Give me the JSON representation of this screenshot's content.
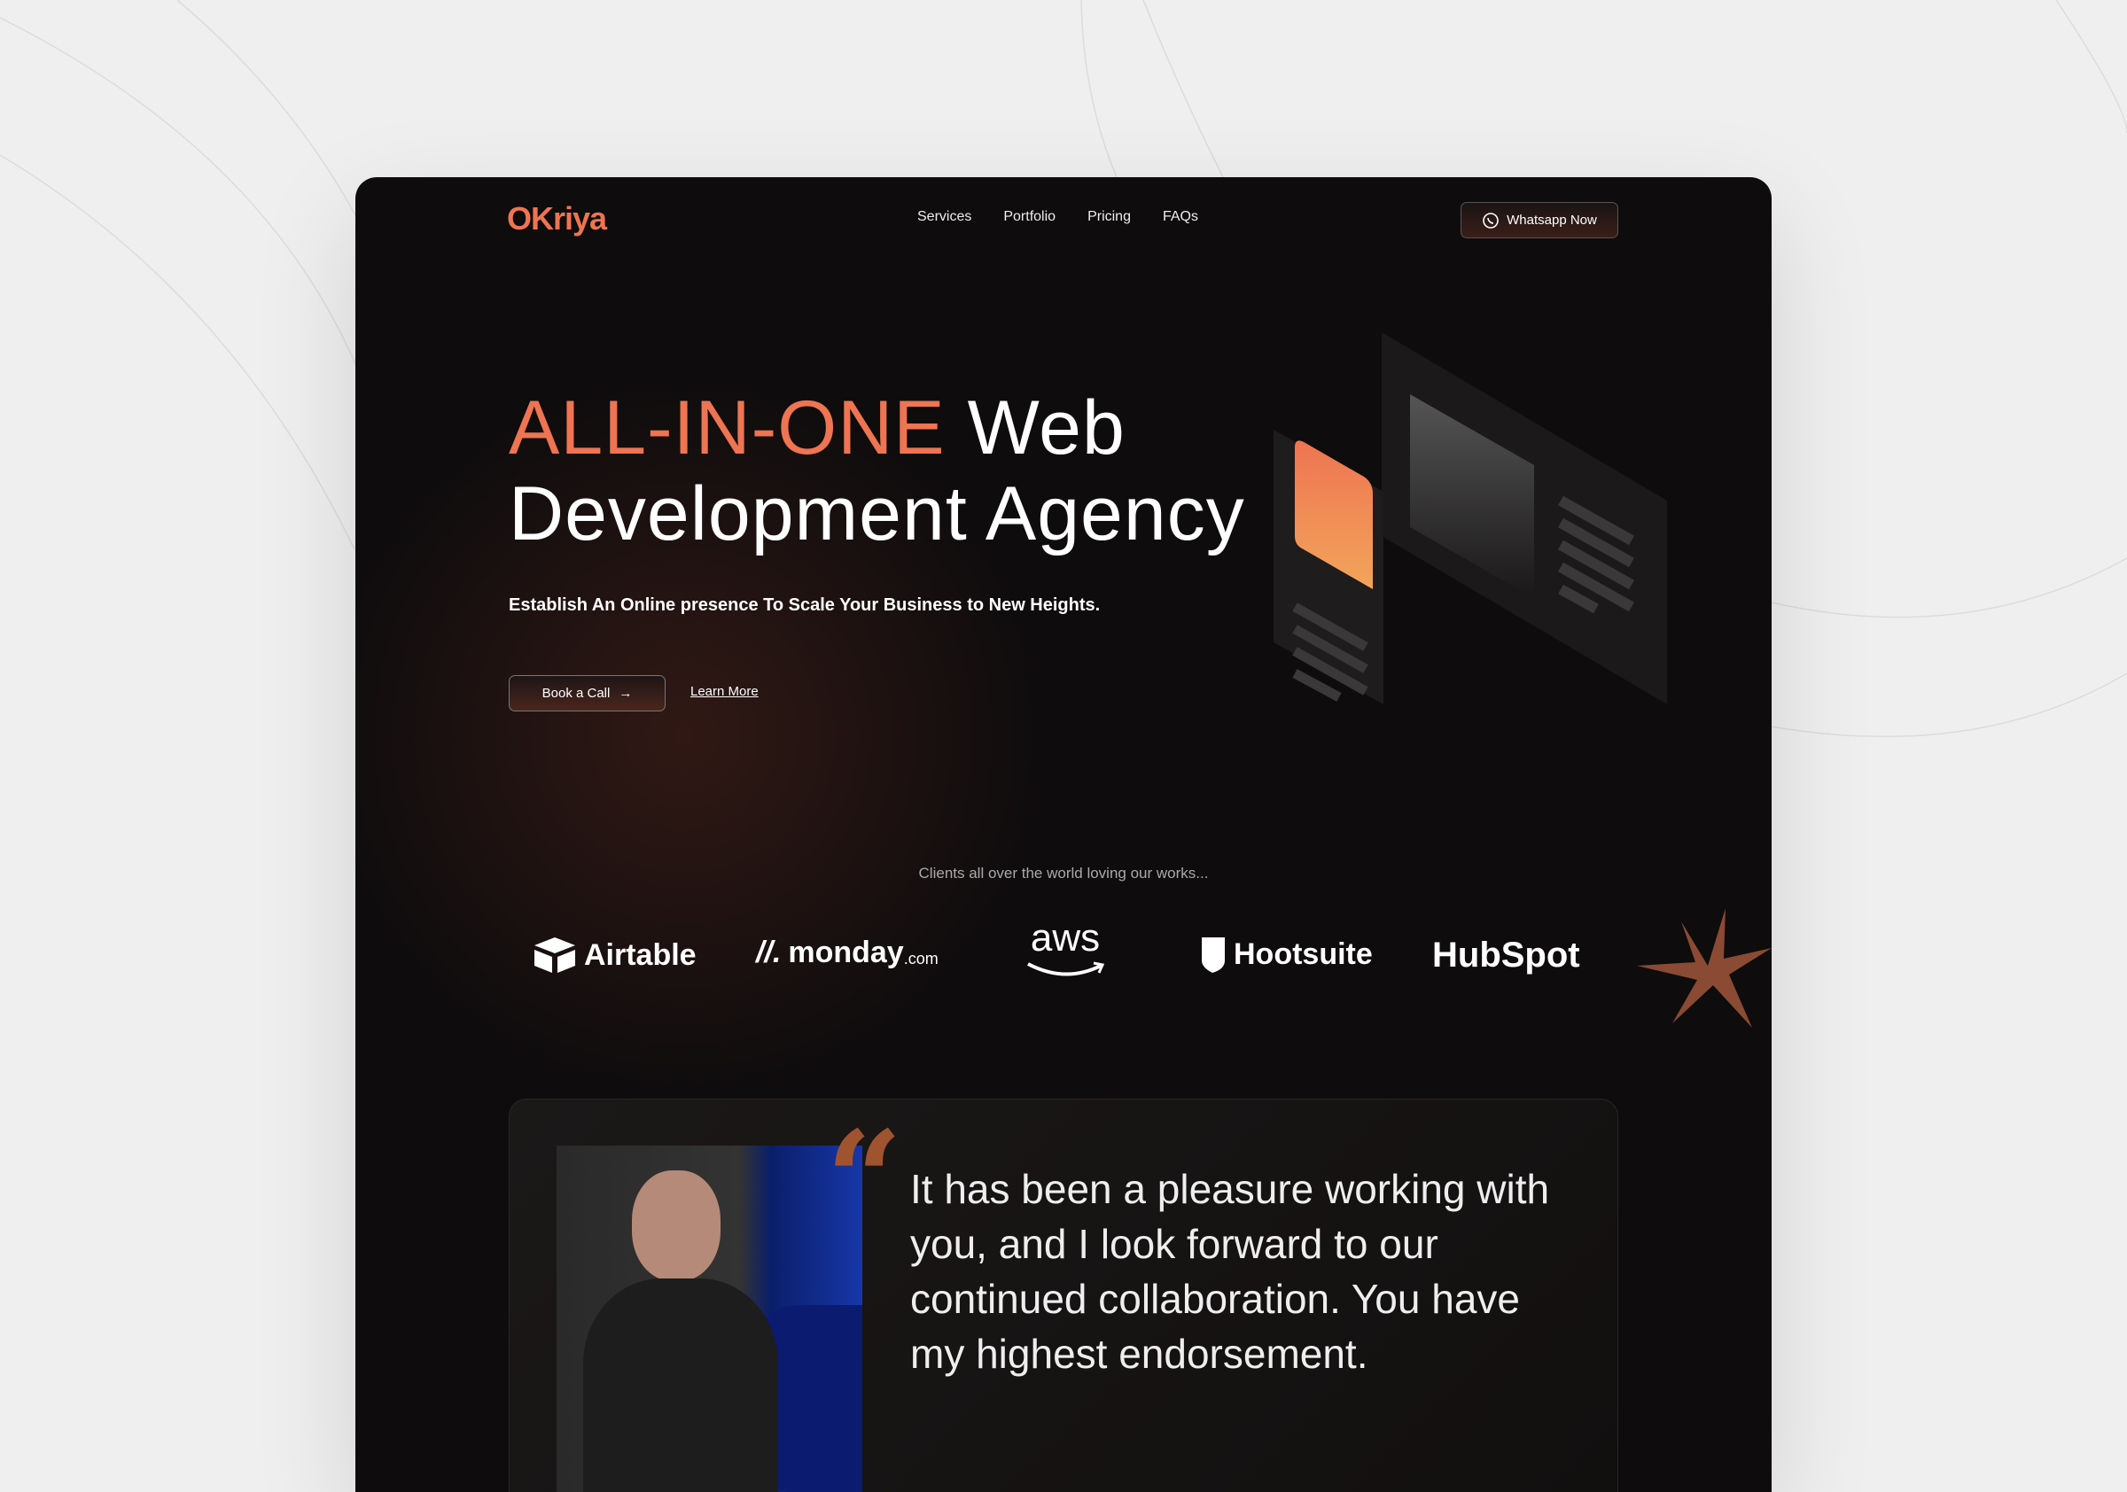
{
  "brand": {
    "logo": "OKriya",
    "accent": "#ee7452"
  },
  "nav": {
    "items": [
      {
        "label": "Services"
      },
      {
        "label": "Portfolio"
      },
      {
        "label": "Pricing"
      },
      {
        "label": "FAQs"
      }
    ],
    "cta": {
      "label": "Whatsapp Now",
      "icon": "whatsapp-icon"
    }
  },
  "hero": {
    "title_accent": "ALL-IN-ONE",
    "title_rest": " Web",
    "title_line2": "Development Agency",
    "subtitle": "Establish An Online presence To Scale Your Business to New Heights.",
    "primary": {
      "label": "Book a Call",
      "icon": "arrow-right-icon"
    },
    "secondary": {
      "label": "Learn More"
    }
  },
  "clients": {
    "heading": "Clients all over the world loving our works...",
    "logos": [
      {
        "name": "Airtable"
      },
      {
        "name": "monday",
        "suffix": ".com"
      },
      {
        "name": "aws"
      },
      {
        "name": "Hootsuite"
      },
      {
        "name": "HubSpot"
      }
    ]
  },
  "testimonial": {
    "quote": "It has been a pleasure working with you, and I look forward to our continued collaboration. You have my highest endorsement."
  }
}
